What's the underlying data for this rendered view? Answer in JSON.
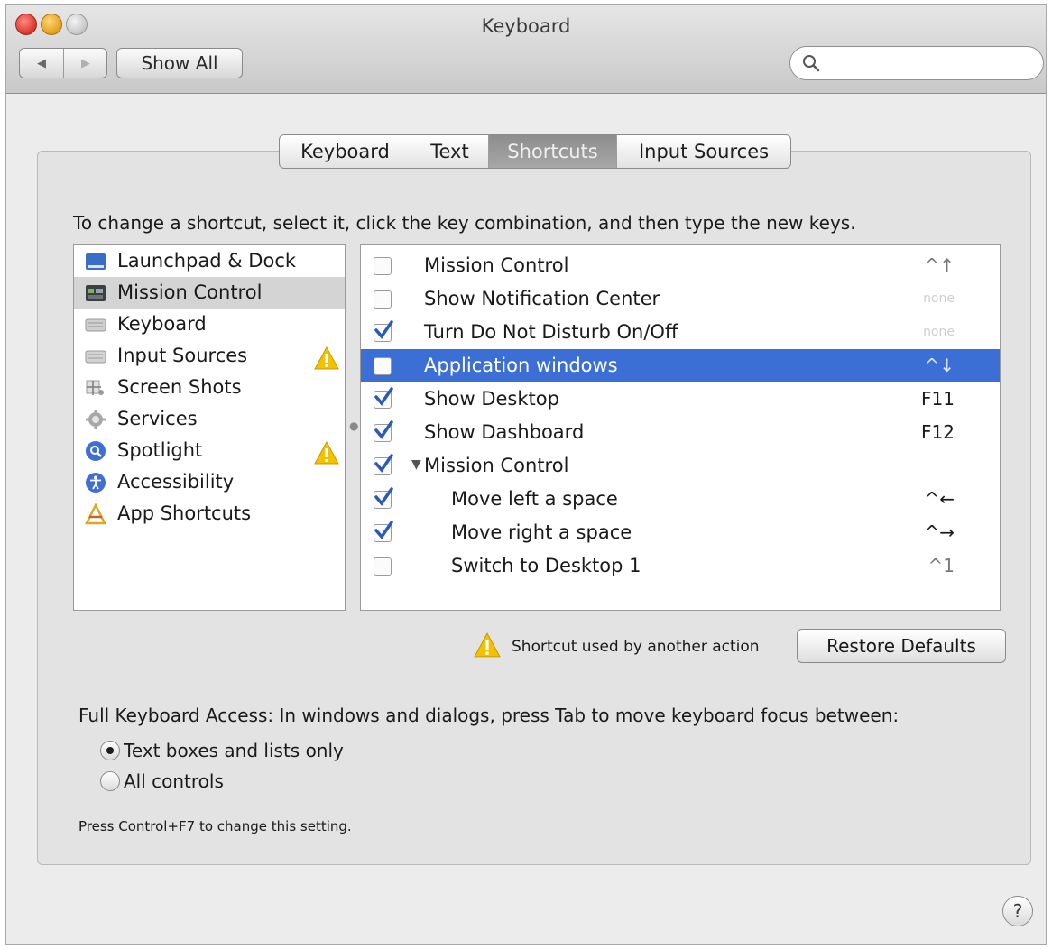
{
  "window": {
    "title": "Keyboard"
  },
  "toolbar": {
    "back_glyph": "◀",
    "forward_glyph": "▶",
    "show_all_label": "Show All",
    "search_placeholder": "",
    "search_icon": "magnifier-icon"
  },
  "tabs": [
    {
      "label": "Keyboard",
      "selected": false
    },
    {
      "label": "Text",
      "selected": false
    },
    {
      "label": "Shortcuts",
      "selected": true
    },
    {
      "label": "Input Sources",
      "selected": false
    }
  ],
  "instruction": "To change a shortcut, select it, click the key combination, and then type the new keys.",
  "categories": [
    {
      "label": "Launchpad & Dock",
      "icon": "launchpad-icon",
      "selected": false,
      "warning": false
    },
    {
      "label": "Mission Control",
      "icon": "mission-control-icon",
      "selected": true,
      "warning": false
    },
    {
      "label": "Keyboard",
      "icon": "keyboard-icon",
      "selected": false,
      "warning": false
    },
    {
      "label": "Input Sources",
      "icon": "input-sources-icon",
      "selected": false,
      "warning": true
    },
    {
      "label": "Screen Shots",
      "icon": "screenshot-icon",
      "selected": false,
      "warning": false
    },
    {
      "label": "Services",
      "icon": "services-gear-icon",
      "selected": false,
      "warning": false
    },
    {
      "label": "Spotlight",
      "icon": "spotlight-icon",
      "selected": false,
      "warning": true
    },
    {
      "label": "Accessibility",
      "icon": "accessibility-icon",
      "selected": false,
      "warning": false
    },
    {
      "label": "App Shortcuts",
      "icon": "app-shortcuts-icon",
      "selected": false,
      "warning": false
    }
  ],
  "shortcuts": [
    {
      "label": "Mission Control",
      "key": "^↑",
      "checked": false,
      "selected": false,
      "indent": 0,
      "disclosure": false,
      "key_style": "grey"
    },
    {
      "label": "Show Notification Center",
      "key": "none",
      "checked": false,
      "selected": false,
      "indent": 0,
      "disclosure": false,
      "key_style": "dim"
    },
    {
      "label": "Turn Do Not Disturb On/Off",
      "key": "none",
      "checked": true,
      "selected": false,
      "indent": 0,
      "disclosure": false,
      "key_style": "dim"
    },
    {
      "label": "Application windows",
      "key": "^↓",
      "checked": false,
      "selected": true,
      "indent": 0,
      "disclosure": false,
      "key_style": "grey"
    },
    {
      "label": "Show Desktop",
      "key": "F11",
      "checked": true,
      "selected": false,
      "indent": 0,
      "disclosure": false,
      "key_style": "normal"
    },
    {
      "label": "Show Dashboard",
      "key": "F12",
      "checked": true,
      "selected": false,
      "indent": 0,
      "disclosure": false,
      "key_style": "normal"
    },
    {
      "label": "Mission Control",
      "key": "",
      "checked": true,
      "selected": false,
      "indent": 0,
      "disclosure": true,
      "key_style": "normal"
    },
    {
      "label": "Move left a space",
      "key": "^←",
      "checked": true,
      "selected": false,
      "indent": 1,
      "disclosure": false,
      "key_style": "normal"
    },
    {
      "label": "Move right a space",
      "key": "^→",
      "checked": true,
      "selected": false,
      "indent": 1,
      "disclosure": false,
      "key_style": "normal"
    },
    {
      "label": "Switch to Desktop 1",
      "key": "^1",
      "checked": false,
      "selected": false,
      "indent": 1,
      "disclosure": false,
      "key_style": "grey"
    }
  ],
  "conflict_note": "Shortcut used by another action",
  "restore_label": "Restore Defaults",
  "full_keyboard_access": "Full Keyboard Access: In windows and dialogs, press Tab to move keyboard focus between:",
  "fka_options": [
    {
      "label": "Text boxes and lists only",
      "selected": true
    },
    {
      "label": "All controls",
      "selected": false
    }
  ],
  "hint": "Press Control+F7 to change this setting.",
  "help_glyph": "?",
  "colors": {
    "selection_blue": "#3b6fd6",
    "warning_yellow": "#f2c200",
    "checkbox_blue": "#2a5bb8"
  }
}
